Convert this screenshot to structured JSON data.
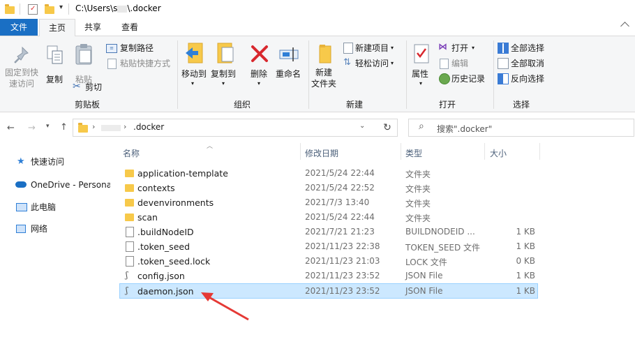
{
  "window": {
    "title": "C:\\Users\\s",
    "title_tail": "\\.docker"
  },
  "tabs": [
    "文件",
    "主页",
    "共享",
    "查看"
  ],
  "ribbon": {
    "clipboard": {
      "pin_label_1": "固定到快",
      "pin_label_2": "速访问",
      "copy": "复制",
      "paste": "粘贴",
      "copy_path": "复制路径",
      "paste_shortcut": "粘贴快捷方式",
      "cut": "剪切",
      "group": "剪贴板"
    },
    "organize": {
      "move_to": "移动到",
      "copy_to": "复制到",
      "delete": "删除",
      "rename": "重命名",
      "group": "组织"
    },
    "new": {
      "new_folder_1": "新建",
      "new_folder_2": "文件夹",
      "new_item": "新建项目",
      "easy_access": "轻松访问",
      "group": "新建"
    },
    "open": {
      "properties": "属性",
      "open": "打开",
      "edit": "编辑",
      "history": "历史记录",
      "group": "打开"
    },
    "select": {
      "select_all": "全部选择",
      "select_none": "全部取消",
      "invert": "反向选择",
      "group": "选择"
    }
  },
  "address": {
    "crumb": ".docker",
    "search_placeholder": "搜索\".docker\""
  },
  "sidebar": [
    {
      "label": "快速访问",
      "icon": "star-icon"
    },
    {
      "label": "OneDrive - Persona",
      "icon": "cloud-icon"
    },
    {
      "label": "此电脑",
      "icon": "computer-icon"
    },
    {
      "label": "网络",
      "icon": "network-icon"
    }
  ],
  "columns": {
    "name": "名称",
    "date": "修改日期",
    "type": "类型",
    "size": "大小"
  },
  "files": [
    {
      "name": "application-template",
      "date": "2021/5/24 22:44",
      "type": "文件夹",
      "size": "",
      "kind": "folder"
    },
    {
      "name": "contexts",
      "date": "2021/5/24 22:52",
      "type": "文件夹",
      "size": "",
      "kind": "folder"
    },
    {
      "name": "devenvironments",
      "date": "2021/7/3 13:40",
      "type": "文件夹",
      "size": "",
      "kind": "folder"
    },
    {
      "name": "scan",
      "date": "2021/5/24 22:44",
      "type": "文件夹",
      "size": "",
      "kind": "folder"
    },
    {
      "name": ".buildNodeID",
      "date": "2021/7/21 21:23",
      "type": "BUILDNODEID ...",
      "size": "1 KB",
      "kind": "file"
    },
    {
      "name": ".token_seed",
      "date": "2021/11/23 22:38",
      "type": "TOKEN_SEED 文件",
      "size": "1 KB",
      "kind": "file"
    },
    {
      "name": ".token_seed.lock",
      "date": "2021/11/23 21:03",
      "type": "LOCK 文件",
      "size": "0 KB",
      "kind": "file"
    },
    {
      "name": "config.json",
      "date": "2021/11/23 23:52",
      "type": "JSON File",
      "size": "1 KB",
      "kind": "json"
    },
    {
      "name": "daemon.json",
      "date": "2021/11/23 23:52",
      "type": "JSON File",
      "size": "1 KB",
      "kind": "json",
      "selected": true
    }
  ],
  "colors": {
    "accent": "#1a6fc4",
    "selection": "#cce8ff",
    "annotation_arrow": "#e53935"
  }
}
